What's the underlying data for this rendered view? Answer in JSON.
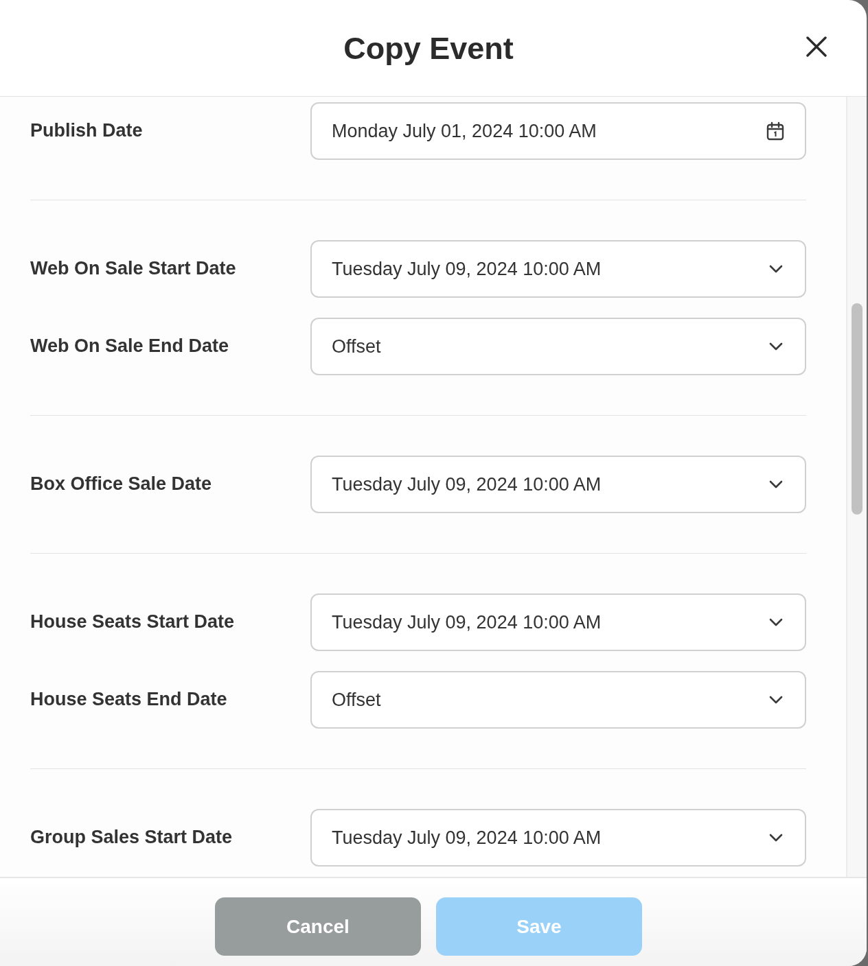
{
  "dialog": {
    "title": "Copy Event"
  },
  "sections": [
    {
      "fields": [
        {
          "label": "Publish Date",
          "kind": "date",
          "value": "Monday July 01, 2024 10:00 AM"
        }
      ]
    },
    {
      "fields": [
        {
          "label": "Web On Sale Start Date",
          "kind": "select",
          "value": "Tuesday July 09, 2024 10:00 AM"
        },
        {
          "label": "Web On Sale End Date",
          "kind": "select",
          "value": "Offset"
        }
      ]
    },
    {
      "fields": [
        {
          "label": "Box Office Sale Date",
          "kind": "select",
          "value": "Tuesday July 09, 2024 10:00 AM"
        }
      ]
    },
    {
      "fields": [
        {
          "label": "House Seats Start Date",
          "kind": "select",
          "value": "Tuesday July 09, 2024 10:00 AM"
        },
        {
          "label": "House Seats End Date",
          "kind": "select",
          "value": "Offset"
        }
      ]
    },
    {
      "fields": [
        {
          "label": "Group Sales Start Date",
          "kind": "select",
          "value": "Tuesday July 09, 2024 10:00 AM"
        }
      ]
    }
  ],
  "buttons": [
    {
      "label": "Cancel",
      "kind": "secondary",
      "disabled": false
    },
    {
      "label": "Save",
      "kind": "primary",
      "disabled": true
    }
  ]
}
